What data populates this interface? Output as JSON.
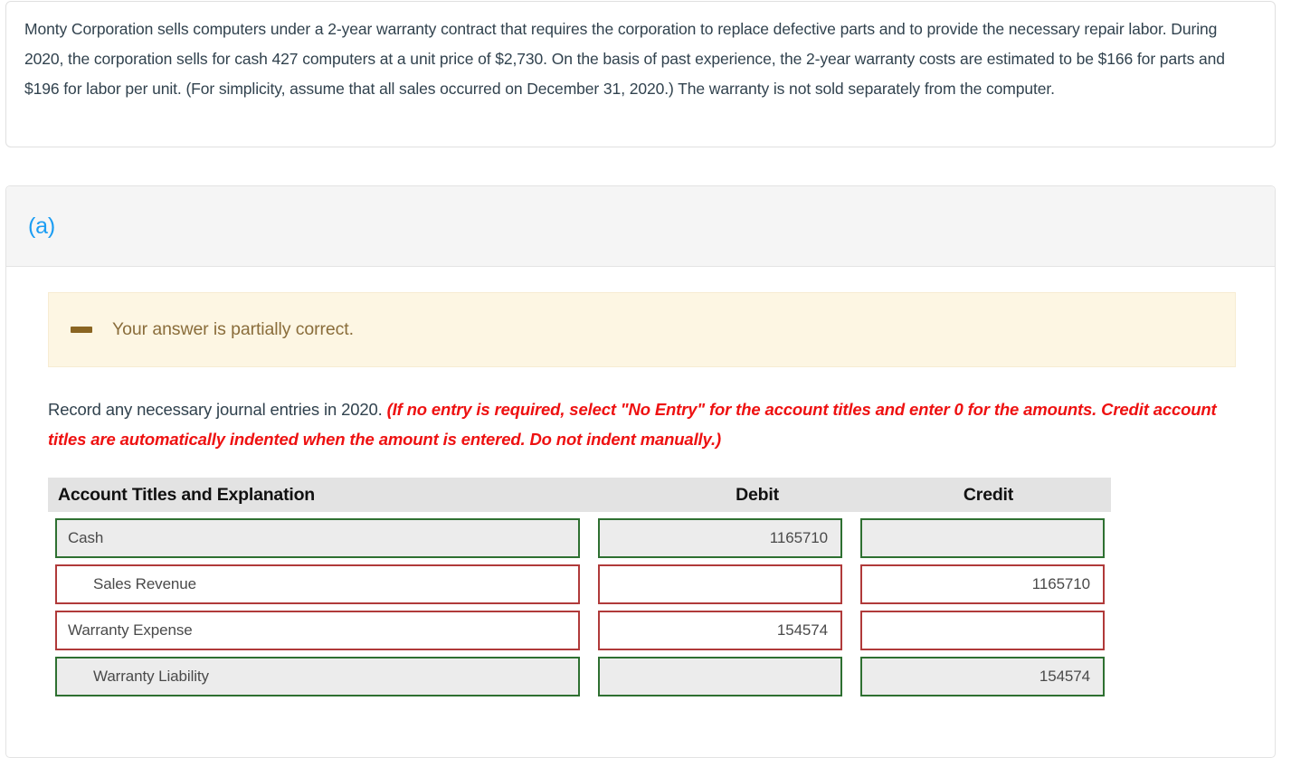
{
  "problem": {
    "text": "Monty Corporation sells computers under a 2-year warranty contract that requires the corporation to replace defective parts and to provide the necessary repair labor. During 2020, the corporation sells for cash 427 computers at a unit price of $2,730. On the basis of past experience, the 2-year warranty costs are estimated to be $166 for parts and $196 for labor per unit. (For simplicity, assume that all sales occurred on December 31, 2020.) The warranty is not sold separately from the computer."
  },
  "part": {
    "label": "(a)",
    "feedback": {
      "icon": "minus-dash-icon",
      "message": "Your answer is partially correct."
    },
    "instruction": {
      "lead": "Record any necessary journal entries in 2020. ",
      "hint": "(If no entry is required, select \"No Entry\" for the account titles and enter 0 for the amounts. Credit account titles are automatically indented when the amount is entered. Do not indent manually.)"
    },
    "table": {
      "headers": {
        "account": "Account Titles and Explanation",
        "debit": "Debit",
        "credit": "Credit"
      },
      "rows": [
        {
          "account": "Cash",
          "account_state": "correct",
          "account_indent": false,
          "debit": "1165710",
          "debit_state": "correct",
          "credit": "",
          "credit_state": "correct"
        },
        {
          "account": "Sales Revenue",
          "account_state": "wrong",
          "account_indent": true,
          "debit": "",
          "debit_state": "wrong",
          "credit": "1165710",
          "credit_state": "wrong"
        },
        {
          "account": "Warranty Expense",
          "account_state": "wrong",
          "account_indent": false,
          "debit": "154574",
          "debit_state": "wrong",
          "credit": "",
          "credit_state": "wrong"
        },
        {
          "account": "Warranty Liability",
          "account_state": "correct",
          "account_indent": true,
          "debit": "",
          "debit_state": "correct",
          "credit": "154574",
          "credit_state": "correct"
        }
      ]
    }
  },
  "colors": {
    "correct_border": "#2e7031",
    "wrong_border": "#b03a3a",
    "accent_link": "#1b9df3",
    "hint_red": "#ee1111",
    "banner_bg": "#fdf6e3",
    "banner_text": "#8a6d3b"
  }
}
